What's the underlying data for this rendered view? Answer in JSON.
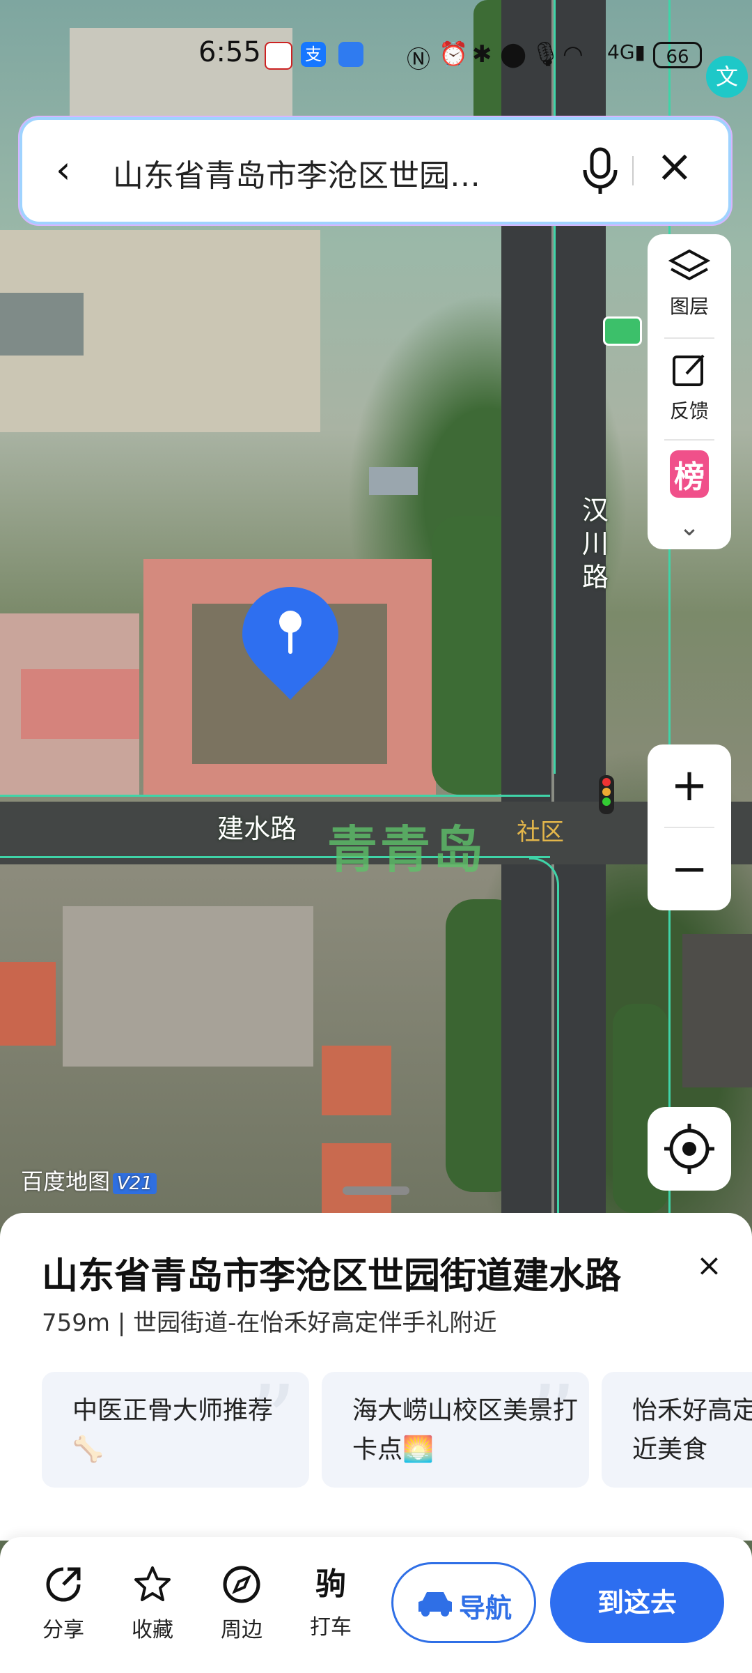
{
  "status_bar": {
    "time": "6:55",
    "battery": "66",
    "network": "4G",
    "app_icons": [
      "app-badge-icon",
      "alipay-icon",
      "shield-app-icon"
    ],
    "system_icons": [
      "nfc-icon",
      "alarm-icon",
      "bluetooth-icon",
      "location-icon",
      "mic-icon",
      "wifi-icon",
      "signal-icon"
    ],
    "translate_label": "文"
  },
  "search": {
    "query": "山东省青岛市李沧区世园…"
  },
  "side_panel": {
    "items": [
      {
        "label": "图层",
        "icon": "layers-icon"
      },
      {
        "label": "反馈",
        "icon": "feedback-icon"
      },
      {
        "label": "榜",
        "icon": "ranking-icon"
      }
    ]
  },
  "zoom": {
    "plus": "+",
    "minus": "−"
  },
  "map": {
    "road_vertical": "汉川路",
    "road_horizontal": "建水路",
    "watermark": "青青岛",
    "watermark_sub": "社区",
    "brand": "百度地图",
    "brand_version": "V21",
    "colors": {
      "road_outline": "#3fd4a8",
      "pin": "#2e6ff0"
    }
  },
  "place": {
    "title": "山东省青岛市李沧区世园街道建水路",
    "subtitle": "759m | 世园街道-在怡禾好高定伴手礼附近",
    "close": "×"
  },
  "cards": [
    {
      "text": "中医正骨大师推荐🦴"
    },
    {
      "text": "海大崂山校区美景打卡点🌅"
    },
    {
      "text": "怡禾好高定伴手礼附近美食"
    }
  ],
  "bottom_bar": {
    "actions": [
      {
        "label": "分享",
        "icon": "share-icon"
      },
      {
        "label": "收藏",
        "icon": "star-icon"
      },
      {
        "label": "周边",
        "icon": "compass-icon"
      },
      {
        "label": "打车",
        "icon": "taxi-icon"
      }
    ],
    "navigate": "导航",
    "go_here": "到这去",
    "accent": "#2d6ef0"
  }
}
